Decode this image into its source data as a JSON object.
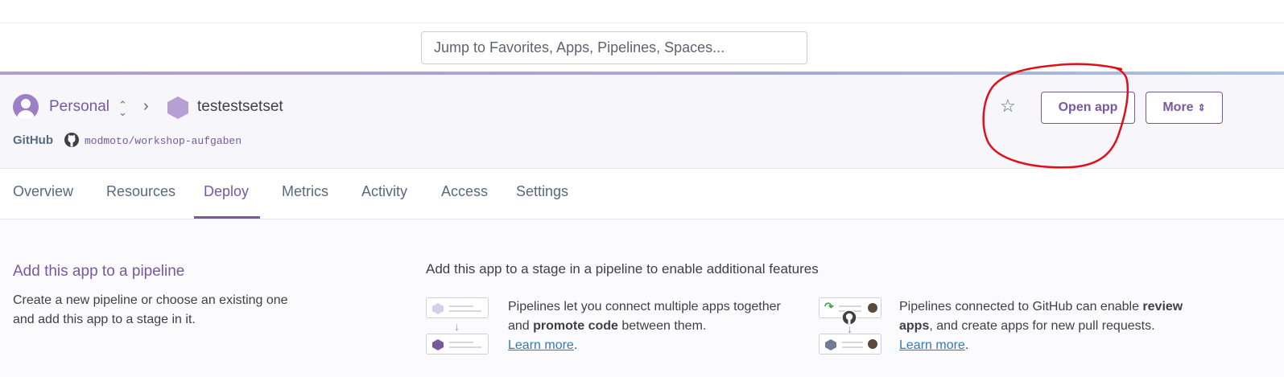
{
  "search": {
    "placeholder": "Jump to Favorites, Apps, Pipelines, Spaces..."
  },
  "breadcrumb": {
    "team": "Personal",
    "app_name": "testestsetset"
  },
  "github": {
    "label": "GitHub",
    "repo": "modmoto/workshop-aufgaben"
  },
  "actions": {
    "open_app": "Open app",
    "more": "More"
  },
  "tabs": [
    {
      "label": "Overview"
    },
    {
      "label": "Resources"
    },
    {
      "label": "Deploy",
      "active": true
    },
    {
      "label": "Metrics"
    },
    {
      "label": "Activity"
    },
    {
      "label": "Access"
    },
    {
      "label": "Settings"
    }
  ],
  "pipeline": {
    "title": "Add this app to a pipeline",
    "description": "Create a new pipeline or choose an existing one and add this app to a stage in it.",
    "heading": "Add this app to a stage in a pipeline to enable additional features",
    "features": [
      {
        "text_before": "Pipelines let you connect multiple apps together and ",
        "bold": "promote code",
        "text_after": " between them.",
        "link": "Learn more",
        "suffix": "."
      },
      {
        "text_before": "Pipelines connected to GitHub can enable ",
        "bold": "review apps",
        "text_after": ", and create apps for new pull requests.",
        "link": "Learn more",
        "suffix": "."
      }
    ]
  },
  "colors": {
    "accent": "#79589f",
    "link": "#2e7ac0",
    "annotation": "#e0101a",
    "header_bg": "#f7f7fb"
  },
  "icons": {
    "avatar": "user-avatar-icon",
    "app": "hexagon-app-icon",
    "github": "github-icon",
    "favorite": "star-outline-icon",
    "more_chevron": "chevron-up-down-icon"
  }
}
